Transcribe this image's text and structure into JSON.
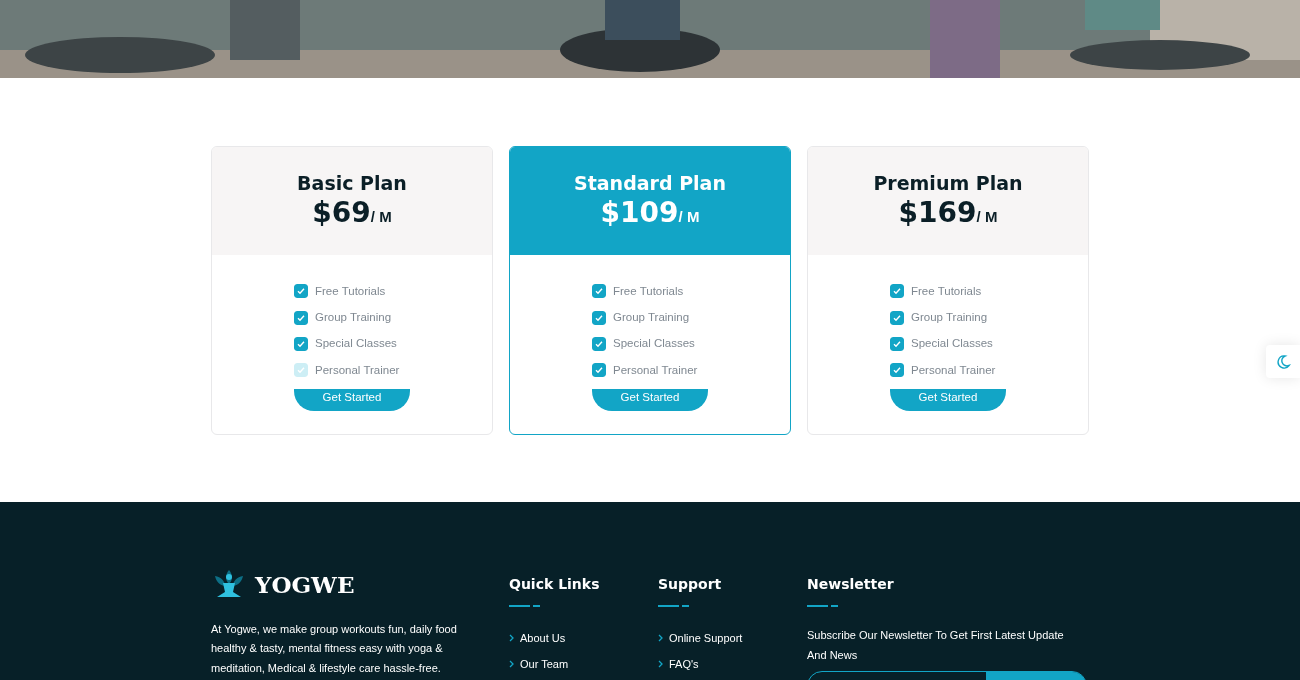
{
  "plans": [
    {
      "name": "Basic Plan",
      "price": "$69",
      "period": "/ M",
      "selected": false,
      "features": [
        {
          "label": "Free Tutorials",
          "checked": true
        },
        {
          "label": "Group Training",
          "checked": true
        },
        {
          "label": "Special Classes",
          "checked": true
        },
        {
          "label": "Personal Trainer",
          "checked": false
        }
      ],
      "button": "Get Started"
    },
    {
      "name": "Standard Plan",
      "price": "$109",
      "period": "/ M",
      "selected": true,
      "features": [
        {
          "label": "Free Tutorials",
          "checked": true
        },
        {
          "label": "Group Training",
          "checked": true
        },
        {
          "label": "Special Classes",
          "checked": true
        },
        {
          "label": "Personal Trainer",
          "checked": true
        }
      ],
      "button": "Get Started"
    },
    {
      "name": "Premium Plan",
      "price": "$169",
      "period": "/ M",
      "selected": false,
      "features": [
        {
          "label": "Free Tutorials",
          "checked": true
        },
        {
          "label": "Group Training",
          "checked": true
        },
        {
          "label": "Special Classes",
          "checked": true
        },
        {
          "label": "Personal Trainer",
          "checked": true
        }
      ],
      "button": "Get Started"
    }
  ],
  "footer": {
    "brand": "YOGWE",
    "about": "At Yogwe, we make group workouts fun, daily food healthy & tasty, mental fitness easy with yoga & meditation, Medical & lifestyle care hassle-free.",
    "columns": [
      {
        "title": "Quick Links",
        "links": [
          "About Us",
          "Our Team"
        ]
      },
      {
        "title": "Support",
        "links": [
          "Online Support",
          "FAQ's"
        ]
      }
    ],
    "newsletter": {
      "title": "Newsletter",
      "text": "Subscribe Our Newsletter To Get First Latest Update And News"
    }
  }
}
